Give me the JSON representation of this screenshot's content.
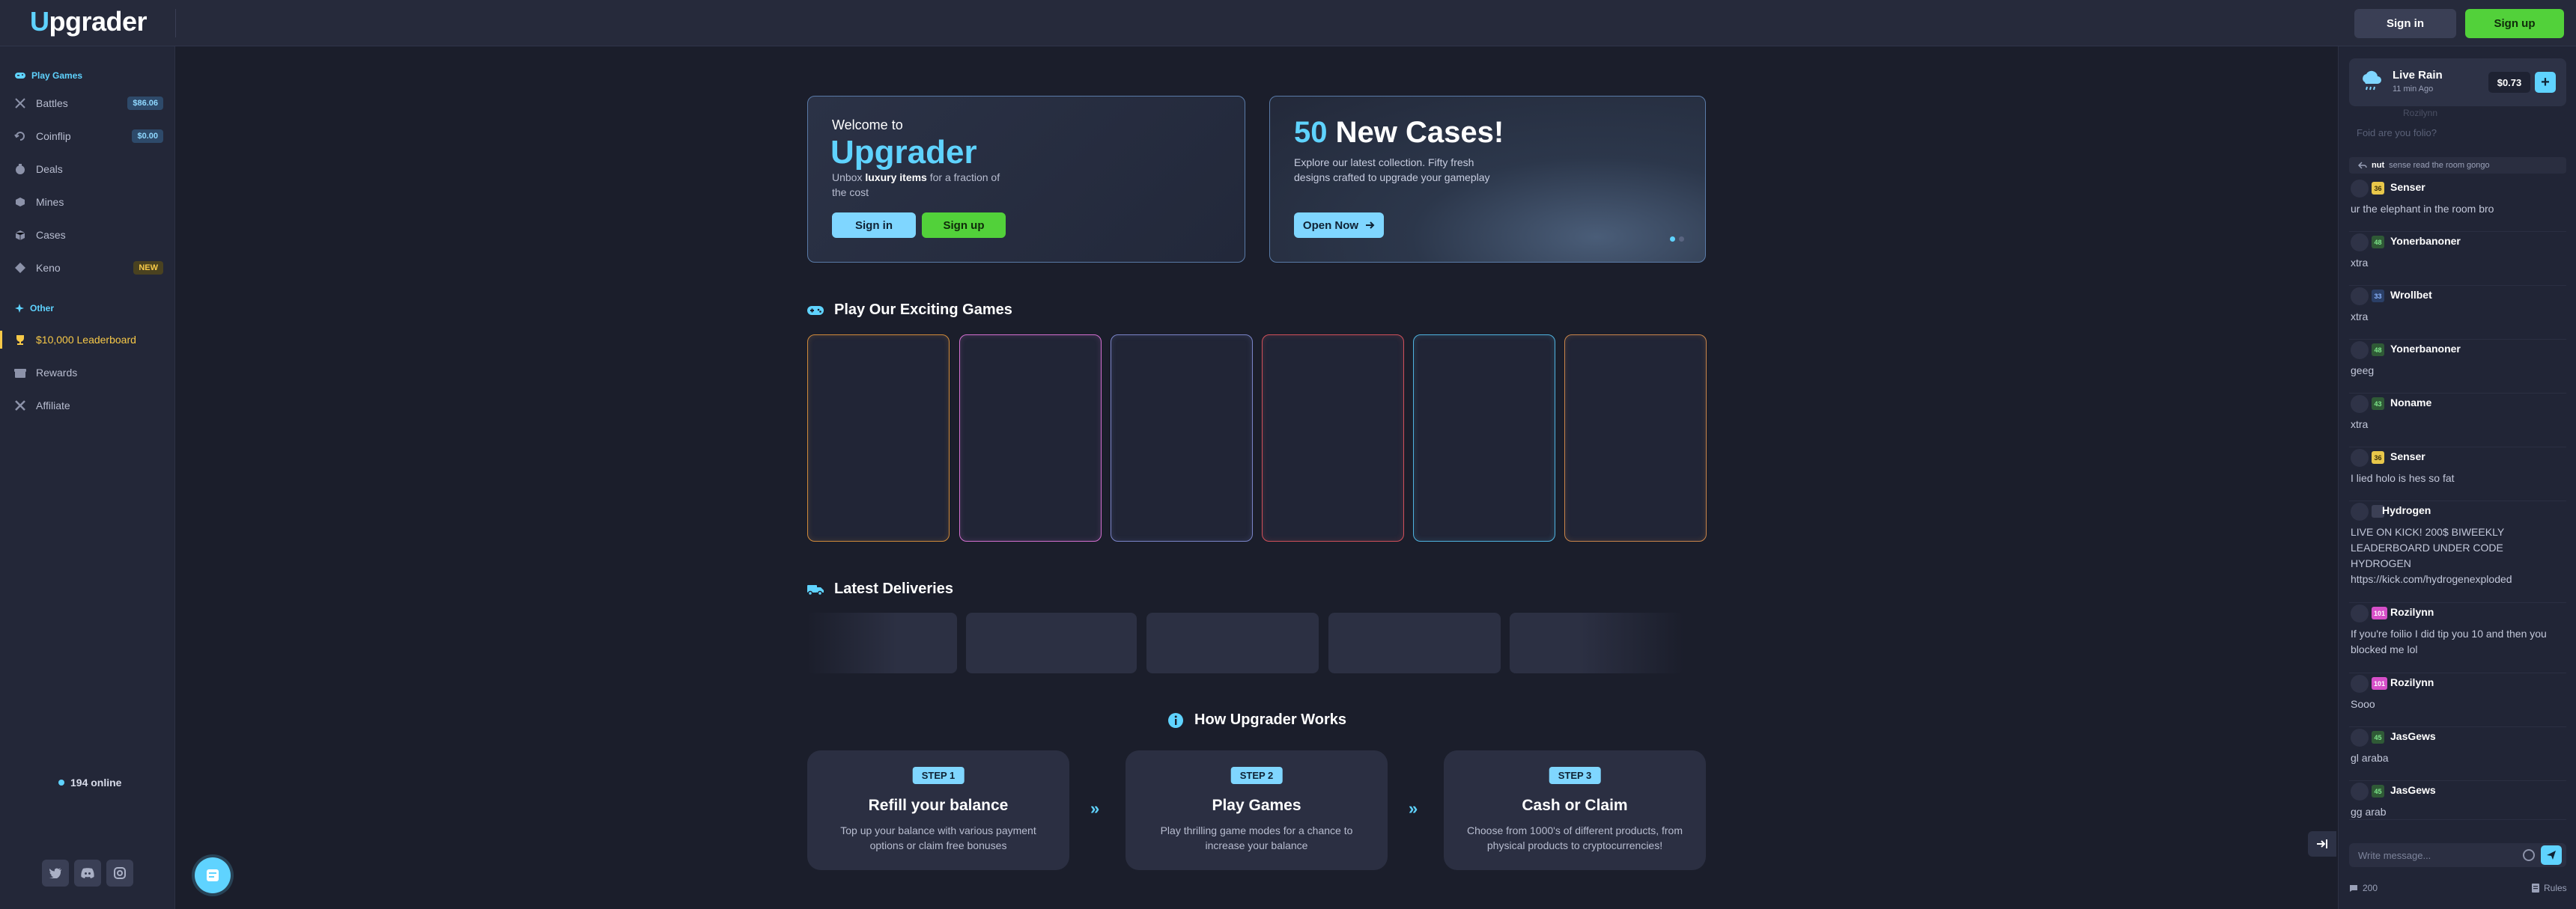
{
  "header": {
    "logo_first": "U",
    "logo_rest": "pgrader",
    "signin": "Sign in",
    "signup": "Sign up"
  },
  "sidebar": {
    "play_games_title": "Play Games",
    "items": [
      {
        "label": "Battles",
        "badge": "$86.06",
        "icon": "swords-icon"
      },
      {
        "label": "Coinflip",
        "badge": "$0.00",
        "icon": "coinflip-icon"
      },
      {
        "label": "Deals",
        "badge": "",
        "icon": "deals-icon"
      },
      {
        "label": "Mines",
        "badge": "",
        "icon": "mines-icon"
      },
      {
        "label": "Cases",
        "badge": "",
        "icon": "cases-icon"
      },
      {
        "label": "Keno",
        "badge": "NEW",
        "icon": "keno-icon"
      }
    ],
    "other_title": "Other",
    "other_items": [
      {
        "label": "$10,000 Leaderboard",
        "icon": "trophy-icon"
      },
      {
        "label": "Rewards",
        "icon": "rewards-icon"
      },
      {
        "label": "Affiliate",
        "icon": "affiliate-icon"
      }
    ],
    "online": "194 online"
  },
  "hero": {
    "welcome": "Welcome to",
    "brand": "Upgrader",
    "desc_pre": "Unbox ",
    "desc_bold": "luxury items",
    "desc_post": " for a fraction of the cost",
    "signin": "Sign in",
    "signup": "Sign up",
    "cases_num": "50",
    "cases_title": " New Cases!",
    "cases_desc": "Explore our latest collection. Fifty fresh designs crafted to upgrade your gameplay",
    "open_now": "Open Now",
    "carousel_active": 1,
    "carousel_total": 2
  },
  "sections": {
    "games": "Play Our Exciting Games",
    "deliveries": "Latest Deliveries",
    "how": "How Upgrader Works"
  },
  "game_card_colors": [
    "#d08a3a",
    "#d36fd0",
    "#7a84c8",
    "#d0505a",
    "#4fb3df",
    "#c8844a"
  ],
  "steps": [
    {
      "pill": "STEP 1",
      "title": "Refill your balance",
      "desc": "Top up your balance with various payment options or claim free bonuses"
    },
    {
      "pill": "STEP 2",
      "title": "Play Games",
      "desc": "Play thrilling game modes for a chance to increase your balance"
    },
    {
      "pill": "STEP 3",
      "title": "Cash or Claim",
      "desc": "Choose from 1000's of different products, from physical products to cryptocurrencies!"
    }
  ],
  "chat": {
    "rain_title": "Live Rain",
    "rain_sub": "11 min Ago",
    "rain_amount": "$0.73",
    "faded_text": "Foid are you folio?",
    "faded_name": "Rozilynn",
    "reply_name": "nut",
    "reply_text": "sense read the room gongo",
    "messages": [
      {
        "level": "36",
        "tone": "gold",
        "name": "Senser",
        "text": "ur the elephant in the room bro"
      },
      {
        "level": "48",
        "tone": "green",
        "name": "Yonerbanoner",
        "text": "xtra"
      },
      {
        "level": "33",
        "tone": "blue",
        "name": "Wrollbet",
        "text": "xtra"
      },
      {
        "level": "48",
        "tone": "green",
        "name": "Yonerbanoner",
        "text": "geeg"
      },
      {
        "level": "43",
        "tone": "green",
        "name": "Noname",
        "text": "xtra"
      },
      {
        "level": "36",
        "tone": "gold",
        "name": "Senser",
        "text": "I lied holo is hes so fat"
      },
      {
        "level": "",
        "tone": "grey",
        "name": "Hydrogen",
        "text": "LIVE ON KICK! 200$ BIWEEKLY LEADERBOARD UNDER CODE HYDROGEN https://kick.com/hydrogenexploded"
      },
      {
        "level": "101",
        "tone": "pink",
        "name": "Rozilynn",
        "text": "If you're foilio I did tip you 10 and then you blocked me lol"
      },
      {
        "level": "101",
        "tone": "pink",
        "name": "Rozilynn",
        "text": "Sooo"
      },
      {
        "level": "45",
        "tone": "green",
        "name": "JasGews",
        "text": "gl araba"
      },
      {
        "level": "45",
        "tone": "green",
        "name": "JasGews",
        "text": "gg arab"
      }
    ],
    "placeholder": "Write message...",
    "count": "200",
    "rules": "Rules"
  }
}
